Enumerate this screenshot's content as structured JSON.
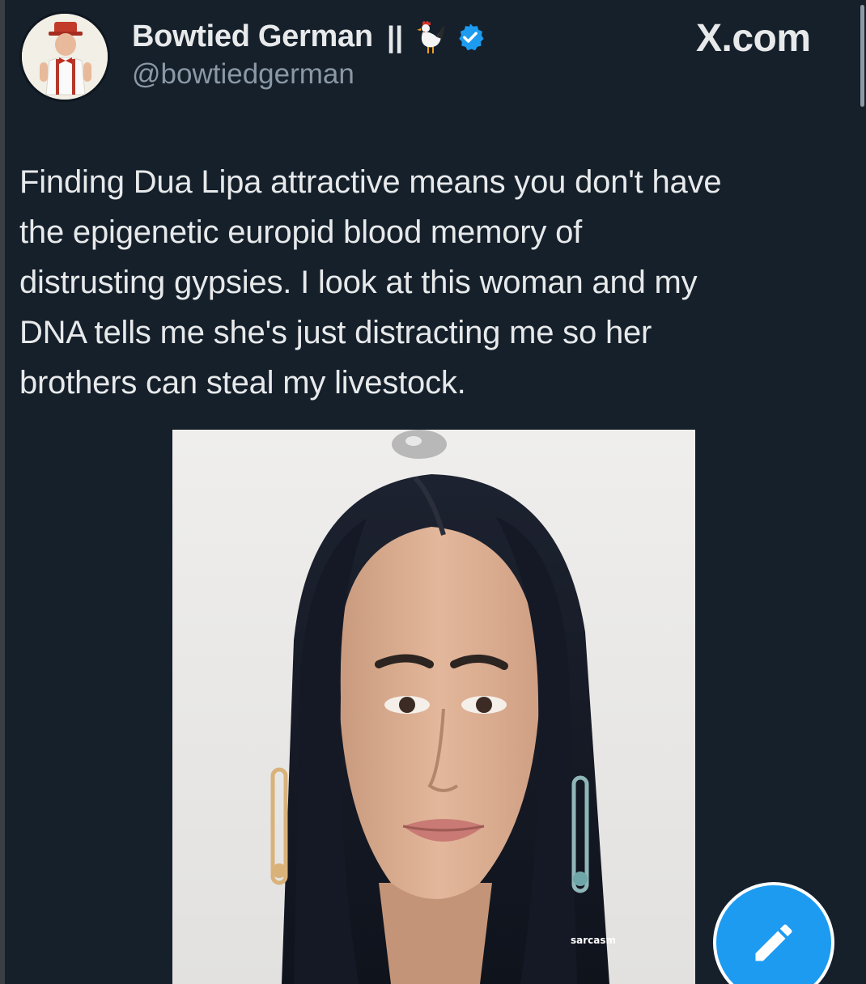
{
  "header": {
    "display_name": "Bowtied German",
    "name_suffix": "||",
    "handle": "@bowtiedgerman",
    "site_label": "X.com"
  },
  "icons": {
    "avatar": "avatar-illustration",
    "name_emoji": "rooster-icon",
    "verified": "verified-badge-icon",
    "compose": "pencil-icon"
  },
  "tweet": {
    "text": "Finding Dua Lipa attractive means you don't have\nthe epigenetic europid blood memory of\ndistrusting gypsies.  I look at this woman and my\nDNA tells me she's just distracting me so her\nbrothers can steal my livestock."
  },
  "media": {
    "watermark": "sarcasm"
  },
  "colors": {
    "background": "#15202b",
    "text": "#e7e9ea",
    "secondary_text": "#8b98a5",
    "accent": "#1d9bf0"
  }
}
